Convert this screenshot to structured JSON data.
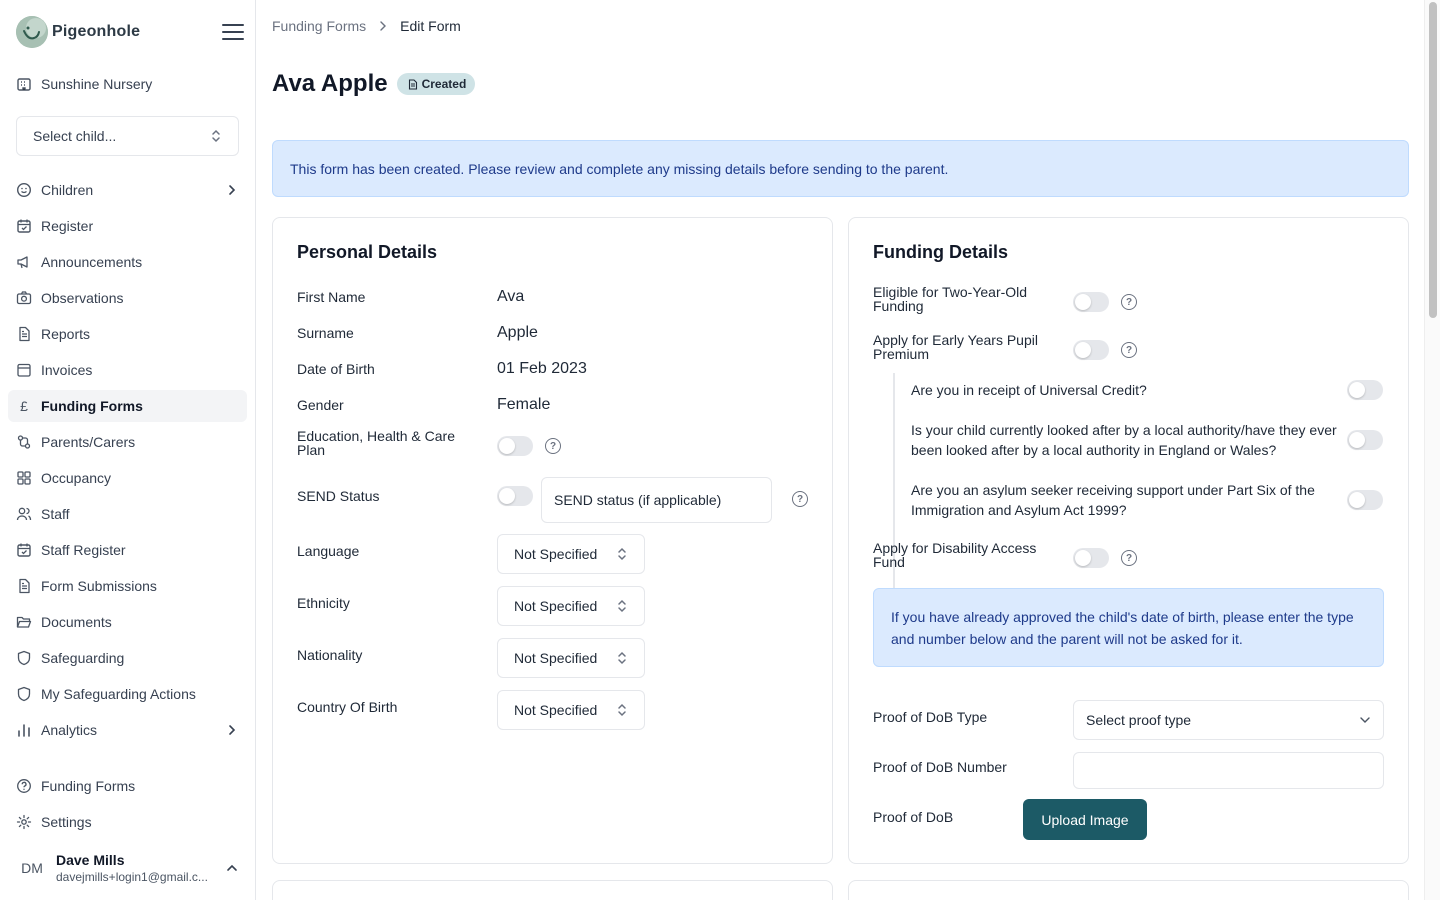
{
  "brand": {
    "name": "Pigeonhole"
  },
  "nursery": {
    "name": "Sunshine Nursery"
  },
  "child_select": {
    "value": "Select child..."
  },
  "nav": {
    "items": [
      {
        "label": "Children",
        "icon": "smile-circle-icon",
        "has_chevron": true
      },
      {
        "label": "Register",
        "icon": "calendar-check-icon"
      },
      {
        "label": "Announcements",
        "icon": "megaphone-icon"
      },
      {
        "label": "Observations",
        "icon": "camera-icon"
      },
      {
        "label": "Reports",
        "icon": "file-text-icon"
      },
      {
        "label": "Invoices",
        "icon": "folder-icon"
      },
      {
        "label": "Funding Forms",
        "icon": "pound-icon",
        "active": true
      },
      {
        "label": "Parents/Carers",
        "icon": "users-link-icon"
      },
      {
        "label": "Occupancy",
        "icon": "grid-icon"
      },
      {
        "label": "Staff",
        "icon": "staff-icon"
      },
      {
        "label": "Staff Register",
        "icon": "calendar-check-icon"
      },
      {
        "label": "Form Submissions",
        "icon": "file-text-icon"
      },
      {
        "label": "Documents",
        "icon": "folder-open-icon"
      },
      {
        "label": "Safeguarding",
        "icon": "shield-icon"
      },
      {
        "label": "My Safeguarding Actions",
        "icon": "shield-icon"
      },
      {
        "label": "Analytics",
        "icon": "bar-chart-icon",
        "has_chevron": true
      }
    ],
    "bottom": [
      {
        "label": "Funding Forms",
        "icon": "help-circle-icon"
      },
      {
        "label": "Settings",
        "icon": "gear-icon"
      }
    ]
  },
  "user": {
    "initials": "DM",
    "name": "Dave Mills",
    "email": "davejmills+login1@gmail.c..."
  },
  "breadcrumb": {
    "parent": "Funding Forms",
    "current": "Edit Form"
  },
  "page": {
    "title": "Ava Apple",
    "status": "Created"
  },
  "alert": {
    "text": "This form has been created. Please review and complete any missing details before sending to the parent."
  },
  "personal": {
    "title": "Personal Details",
    "first_name_label": "First Name",
    "first_name": "Ava",
    "surname_label": "Surname",
    "surname": "Apple",
    "dob_label": "Date of Birth",
    "dob": "01 Feb 2023",
    "gender_label": "Gender",
    "gender": "Female",
    "ehc_label": "Education, Health & Care Plan",
    "send_label": "SEND Status",
    "send_placeholder": "SEND status (if applicable)",
    "language_label": "Language",
    "language": "Not Specified",
    "ethnicity_label": "Ethnicity",
    "ethnicity": "Not Specified",
    "nationality_label": "Nationality",
    "nationality": "Not Specified",
    "country_label": "Country Of Birth",
    "country": "Not Specified"
  },
  "funding": {
    "title": "Funding Details",
    "two_year_label": "Eligible for Two-Year-Old Funding",
    "eypp_label": "Apply for Early Years Pupil Premium",
    "q_universal_credit": "Are you in receipt of Universal Credit?",
    "q_looked_after": "Is your child currently looked after by a local authority/have they ever been looked after by a local authority in England or Wales?",
    "q_asylum": "Are you an asylum seeker receiving support under Part Six of the Immigration and Asylum Act 1999?",
    "daf_label": "Apply for Disability Access Fund",
    "info_text": "If you have already approved the child's date of birth, please enter the type and number below and the parent will not be asked for it.",
    "proof_type_label": "Proof of DoB Type",
    "proof_type_value": "Select proof type",
    "proof_number_label": "Proof of DoB Number",
    "proof_label": "Proof of DoB",
    "upload_label": "Upload Image"
  },
  "colors": {
    "accent": "#1c5a66",
    "alert_bg": "#dbeafe",
    "alert_text": "#1e3a8a",
    "badge_bg": "#cfe3e6"
  }
}
